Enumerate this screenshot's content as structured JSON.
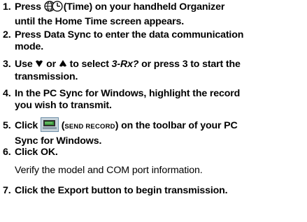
{
  "steps": [
    {
      "number": "1.",
      "line1_a": "Press ",
      "icon": "world-clock-icon",
      "line1_b": "(Time) on your handheld Organizer",
      "line2": "until the Home Time screen appears."
    },
    {
      "number": "2.",
      "line1": "Press Data Sync to enter the data communication",
      "line2": "mode."
    },
    {
      "number": "3.",
      "line1_a": "Use ",
      "down_icon": "down-arrow-icon",
      "line1_b": " or ",
      "up_icon": "up-arrow-icon",
      "line1_c": " to select ",
      "option": "3-Rx?",
      "line1_d": " or press 3 to start the",
      "line2": "transmission."
    },
    {
      "number": "4.",
      "line1": "In the PC Sync for Windows, highlight the record",
      "line2": "you wish to transmit."
    },
    {
      "number": "5.",
      "line1_a": "Click ",
      "icon": "send-record-icon",
      "line1_b": " (",
      "label": "SEND RECORD",
      "line1_c": ") on the toolbar of your PC",
      "line2": "Sync for Windows."
    },
    {
      "number": "6.",
      "line1": "Click OK."
    },
    {
      "number": "7.",
      "line1": "Click the Export  button to begin transmission."
    }
  ],
  "note": "Verify the model and COM port information.",
  "colors": {
    "text": "#000000",
    "send_icon_green": "#3a9a3a",
    "send_icon_frame": "#6f8fa8"
  }
}
